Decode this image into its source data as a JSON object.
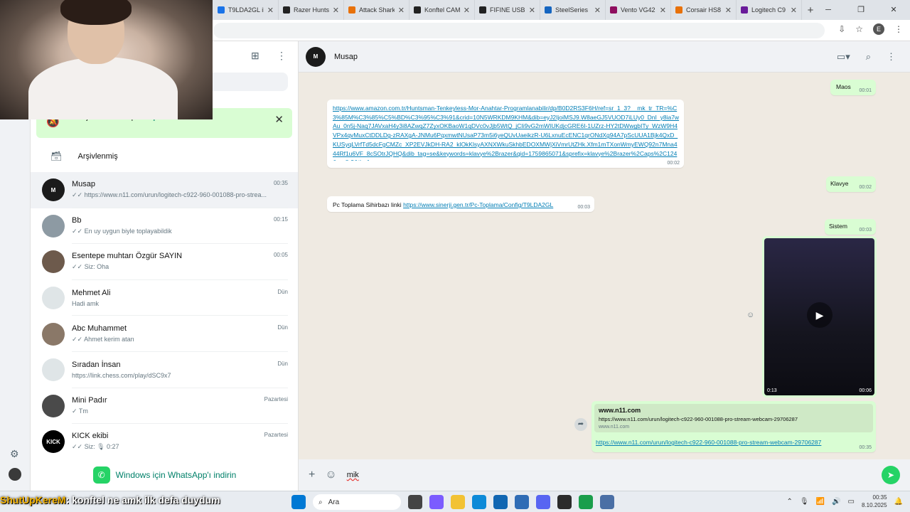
{
  "browser": {
    "tabs": [
      {
        "title": "T9LDA2GL il",
        "color": "#1a73e8"
      },
      {
        "title": "Razer Hunts",
        "color": "#222222"
      },
      {
        "title": "Attack Shark",
        "color": "#e8710a"
      },
      {
        "title": "Konftel CAM",
        "color": "#222222"
      },
      {
        "title": "FIFINE USB",
        "color": "#222222"
      },
      {
        "title": "SteelSeries",
        "color": "#1565c0"
      },
      {
        "title": "Vento VG42",
        "color": "#8e0e5f"
      },
      {
        "title": "Corsair HS8",
        "color": "#e8710a"
      },
      {
        "title": "Logitech C9",
        "color": "#6a1b9a"
      }
    ],
    "new_tab": "+",
    "profile_initial": "E"
  },
  "sidebar": {
    "notification": {
      "text": "Mesaj bildirimleri kapalı.",
      "action": "Aç"
    },
    "archived_label": "Arşivlenmiş",
    "chats": [
      {
        "name": "Musap",
        "time": "00:35",
        "preview": "✓✓ https://www.n11.com/urun/logitech-c922-960-001088-pro-strea...",
        "avatar_color": "#1b1b1b",
        "avatar_text": "M"
      },
      {
        "name": "Bb",
        "time": "00:15",
        "preview": "✓✓ En uy uygun biyle toplayabildik",
        "avatar_color": "#8d9aa3",
        "avatar_text": ""
      },
      {
        "name": "Esentepe muhtarı Özgür SAYIN",
        "time": "00:05",
        "preview": "✓✓ Siz: Oha",
        "avatar_color": "#6d5a4c",
        "avatar_text": ""
      },
      {
        "name": "Mehmet Ali",
        "time": "Dün",
        "preview": "Hadi amk",
        "avatar_color": "#dfe5e7",
        "avatar_text": ""
      },
      {
        "name": "Abc Muhammet",
        "time": "Dün",
        "preview": "✓✓ Ahmet kerim atan",
        "avatar_color": "#8a7868",
        "avatar_text": ""
      },
      {
        "name": "Sıradan İnsan",
        "time": "Dün",
        "preview": "https://link.chess.com/play/dSC9x7",
        "avatar_color": "#dfe5e7",
        "avatar_text": ""
      },
      {
        "name": "Mini Padır",
        "time": "Pazartesi",
        "preview": "✓ Tm",
        "avatar_color": "#4a4a4a",
        "avatar_text": ""
      },
      {
        "name": "KICK ekibi",
        "time": "Pazartesi",
        "preview": "✓✓ Siz: 🎙 0:27",
        "avatar_color": "#000000",
        "avatar_text": "KICK"
      }
    ],
    "download_text": "Windows için WhatsApp'ı indirin"
  },
  "main": {
    "contact_name": "Musap",
    "messages": {
      "maos": {
        "text": "Maos",
        "time": "00:01"
      },
      "amazon": {
        "text": "https://www.amazon.com.tr/Huntsman-Tenkeyless-Mor-Anahtar-Programlanabilir/dp/B0D2RS3F6H/ref=sr_1_3?__mk_tr_TR=%C3%85M%C3%85%C5%BD%C3%95%C3%91&crid=10N5WRKDM9KHM&dib=eyJ2IjoiMSJ9.W8aeGJ5VUOD7iLUy0_DnI_y8ia7wAu_0n5j-Naq7JAVxaH4y3i8AZwqZ7ZyxOKBaoW1qDVc0vJjb5WtQ_jCIi9vG2mWIUKdjcGRE6I-1UZrz-HY2tDWwgbITy_WzW9H4VPx4qvMuxCtDDLDg-zRAXgA-JNMu6PqxmwtNUsaP73m5i6yeQUvUaeikzR-U6LxnuEcENC1qrONdXg94A7pScUUA1Bjk4QxD_KUSyqLVrfTd5dcFgCMZc_XP2EVJkDH-RA2_klOkKlsyAXNXWkuSkhbEDOXMWjXiVmrUtZHk.Xfm1mTXonWmyEWQ92n7Mna444Rf1u6VF_8cSOtrJQHQ&dib_tag=se&keywords=klavye%2Brazer&qid=1759865071&sprefix=klavye%2Brazer%2Caps%2C124&sr=8-3&th=1",
        "time": "00:02"
      },
      "klavye": {
        "text": "Klavye",
        "time": "00:02"
      },
      "pc": {
        "text": "Pc Toplama Sihirbazı linki",
        "link": "https://www.sinerji.gen.tr/Pc-Toplama/Config/T9LDA2GL",
        "time": "00:03"
      },
      "sistem": {
        "text": "Sistem",
        "time": "00:03"
      },
      "video": {
        "duration": "0:13",
        "time": "00:06"
      },
      "n11": {
        "site": "www.n11.com",
        "url": "https://www.n11.com/urun/logitech-c922-960-001088-pro-stream-webcam-29706287",
        "domain": "www.n11.com",
        "link": "https://www.n11.com/urun/logitech-c922-960-001088-pro-stream-webcam-29706287",
        "time": "00:35"
      }
    },
    "compose_value": "mik"
  },
  "overlay_caption": {
    "user": "ShutUpKereM",
    "text": ": konftel ne amk ilk defa duydum"
  },
  "taskbar": {
    "search": "Ara",
    "time": "00:35",
    "date": "8.10.2025"
  }
}
